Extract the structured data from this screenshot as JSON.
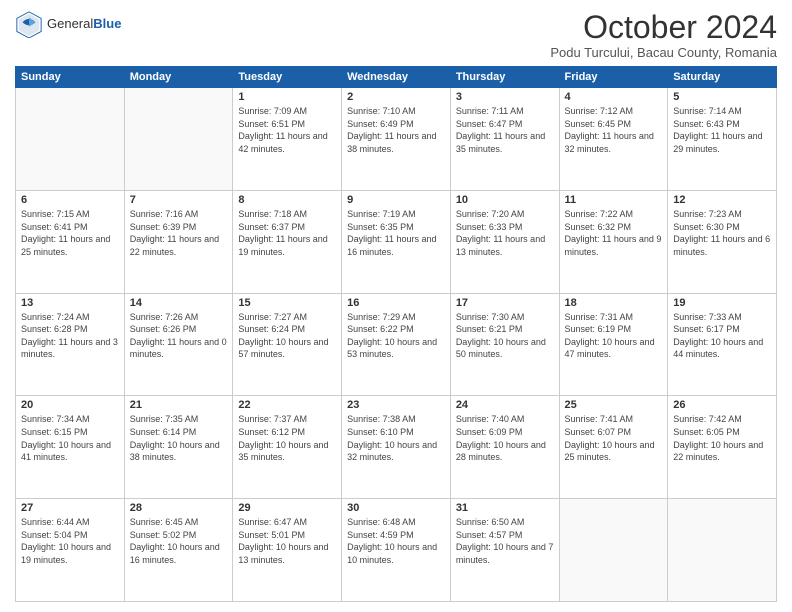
{
  "header": {
    "logo_general": "General",
    "logo_blue": "Blue",
    "month_title": "October 2024",
    "location": "Podu Turcului, Bacau County, Romania"
  },
  "days_of_week": [
    "Sunday",
    "Monday",
    "Tuesday",
    "Wednesday",
    "Thursday",
    "Friday",
    "Saturday"
  ],
  "weeks": [
    [
      {
        "day": "",
        "info": ""
      },
      {
        "day": "",
        "info": ""
      },
      {
        "day": "1",
        "info": "Sunrise: 7:09 AM\nSunset: 6:51 PM\nDaylight: 11 hours and 42 minutes."
      },
      {
        "day": "2",
        "info": "Sunrise: 7:10 AM\nSunset: 6:49 PM\nDaylight: 11 hours and 38 minutes."
      },
      {
        "day": "3",
        "info": "Sunrise: 7:11 AM\nSunset: 6:47 PM\nDaylight: 11 hours and 35 minutes."
      },
      {
        "day": "4",
        "info": "Sunrise: 7:12 AM\nSunset: 6:45 PM\nDaylight: 11 hours and 32 minutes."
      },
      {
        "day": "5",
        "info": "Sunrise: 7:14 AM\nSunset: 6:43 PM\nDaylight: 11 hours and 29 minutes."
      }
    ],
    [
      {
        "day": "6",
        "info": "Sunrise: 7:15 AM\nSunset: 6:41 PM\nDaylight: 11 hours and 25 minutes."
      },
      {
        "day": "7",
        "info": "Sunrise: 7:16 AM\nSunset: 6:39 PM\nDaylight: 11 hours and 22 minutes."
      },
      {
        "day": "8",
        "info": "Sunrise: 7:18 AM\nSunset: 6:37 PM\nDaylight: 11 hours and 19 minutes."
      },
      {
        "day": "9",
        "info": "Sunrise: 7:19 AM\nSunset: 6:35 PM\nDaylight: 11 hours and 16 minutes."
      },
      {
        "day": "10",
        "info": "Sunrise: 7:20 AM\nSunset: 6:33 PM\nDaylight: 11 hours and 13 minutes."
      },
      {
        "day": "11",
        "info": "Sunrise: 7:22 AM\nSunset: 6:32 PM\nDaylight: 11 hours and 9 minutes."
      },
      {
        "day": "12",
        "info": "Sunrise: 7:23 AM\nSunset: 6:30 PM\nDaylight: 11 hours and 6 minutes."
      }
    ],
    [
      {
        "day": "13",
        "info": "Sunrise: 7:24 AM\nSunset: 6:28 PM\nDaylight: 11 hours and 3 minutes."
      },
      {
        "day": "14",
        "info": "Sunrise: 7:26 AM\nSunset: 6:26 PM\nDaylight: 11 hours and 0 minutes."
      },
      {
        "day": "15",
        "info": "Sunrise: 7:27 AM\nSunset: 6:24 PM\nDaylight: 10 hours and 57 minutes."
      },
      {
        "day": "16",
        "info": "Sunrise: 7:29 AM\nSunset: 6:22 PM\nDaylight: 10 hours and 53 minutes."
      },
      {
        "day": "17",
        "info": "Sunrise: 7:30 AM\nSunset: 6:21 PM\nDaylight: 10 hours and 50 minutes."
      },
      {
        "day": "18",
        "info": "Sunrise: 7:31 AM\nSunset: 6:19 PM\nDaylight: 10 hours and 47 minutes."
      },
      {
        "day": "19",
        "info": "Sunrise: 7:33 AM\nSunset: 6:17 PM\nDaylight: 10 hours and 44 minutes."
      }
    ],
    [
      {
        "day": "20",
        "info": "Sunrise: 7:34 AM\nSunset: 6:15 PM\nDaylight: 10 hours and 41 minutes."
      },
      {
        "day": "21",
        "info": "Sunrise: 7:35 AM\nSunset: 6:14 PM\nDaylight: 10 hours and 38 minutes."
      },
      {
        "day": "22",
        "info": "Sunrise: 7:37 AM\nSunset: 6:12 PM\nDaylight: 10 hours and 35 minutes."
      },
      {
        "day": "23",
        "info": "Sunrise: 7:38 AM\nSunset: 6:10 PM\nDaylight: 10 hours and 32 minutes."
      },
      {
        "day": "24",
        "info": "Sunrise: 7:40 AM\nSunset: 6:09 PM\nDaylight: 10 hours and 28 minutes."
      },
      {
        "day": "25",
        "info": "Sunrise: 7:41 AM\nSunset: 6:07 PM\nDaylight: 10 hours and 25 minutes."
      },
      {
        "day": "26",
        "info": "Sunrise: 7:42 AM\nSunset: 6:05 PM\nDaylight: 10 hours and 22 minutes."
      }
    ],
    [
      {
        "day": "27",
        "info": "Sunrise: 6:44 AM\nSunset: 5:04 PM\nDaylight: 10 hours and 19 minutes."
      },
      {
        "day": "28",
        "info": "Sunrise: 6:45 AM\nSunset: 5:02 PM\nDaylight: 10 hours and 16 minutes."
      },
      {
        "day": "29",
        "info": "Sunrise: 6:47 AM\nSunset: 5:01 PM\nDaylight: 10 hours and 13 minutes."
      },
      {
        "day": "30",
        "info": "Sunrise: 6:48 AM\nSunset: 4:59 PM\nDaylight: 10 hours and 10 minutes."
      },
      {
        "day": "31",
        "info": "Sunrise: 6:50 AM\nSunset: 4:57 PM\nDaylight: 10 hours and 7 minutes."
      },
      {
        "day": "",
        "info": ""
      },
      {
        "day": "",
        "info": ""
      }
    ]
  ]
}
